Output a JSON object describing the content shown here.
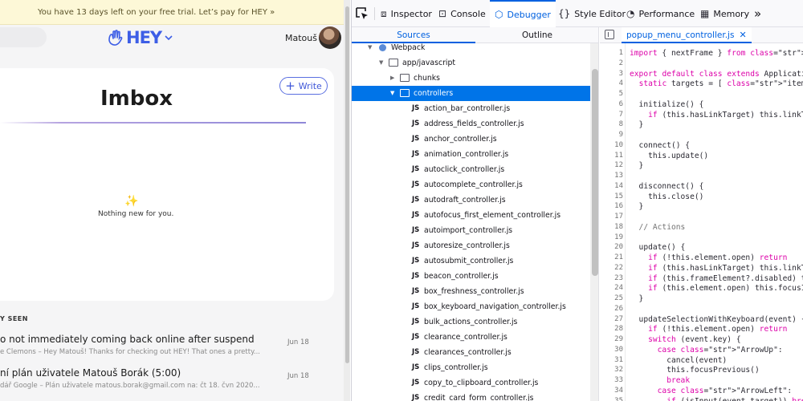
{
  "hey": {
    "trial_banner": "You have 13 days left on your free trial. Let’s pay for HEY »",
    "logo_text": "HEY",
    "user_name": "Matouš",
    "write_label": "Write",
    "imbox_title": "Imbox",
    "empty_message": "Nothing new for you.",
    "seen_heading": "Y SEEN",
    "mails": [
      {
        "subject": "o not immediately coming back online after suspend",
        "preview": "e Clemons – Hey Matouš! Thanks for checking out HEY! That ones a pretty...",
        "date": "Jun 18"
      },
      {
        "subject": "ní plán uživatele Matouš Borák (5:00)",
        "preview": "dář Google – Plán uživatele matous.borak@gmail.com na: čt 18. čvn 2020...",
        "date": "Jun 18"
      }
    ]
  },
  "devtools": {
    "tabs": {
      "inspector": "Inspector",
      "console": "Console",
      "debugger": "Debugger",
      "style_editor": "Style Editor",
      "performance": "Performance",
      "memory": "Memory"
    },
    "sources_tab": "Sources",
    "outline_tab": "Outline",
    "tree": {
      "root": "Webpack",
      "folder_app": "app/javascript",
      "folder_chunks": "chunks",
      "folder_controllers": "controllers",
      "files": [
        "action_bar_controller.js",
        "address_fields_controller.js",
        "anchor_controller.js",
        "animation_controller.js",
        "autoclick_controller.js",
        "autocomplete_controller.js",
        "autodraft_controller.js",
        "autofocus_first_element_controller.js",
        "autoimport_controller.js",
        "autoresize_controller.js",
        "autosubmit_controller.js",
        "beacon_controller.js",
        "box_freshness_controller.js",
        "box_keyboard_navigation_controller.js",
        "bulk_actions_controller.js",
        "clearance_controller.js",
        "clearances_controller.js",
        "clips_controller.js",
        "copy_to_clipboard_controller.js",
        "credit_card_form_controller.js"
      ],
      "js_badge": "JS"
    },
    "editor": {
      "file_tab": "popup_menu_controller.js",
      "lines": [
        {
          "n": "1",
          "code": "import { nextFrame } from \"helpers\""
        },
        {
          "n": "2",
          "code": ""
        },
        {
          "n": "3",
          "code": "export default class extends Application"
        },
        {
          "n": "4",
          "code": "  static targets = [ \"item\", \"link\", \"in"
        },
        {
          "n": "5",
          "code": ""
        },
        {
          "n": "6",
          "code": "  initialize() {"
        },
        {
          "n": "7",
          "code": "    if (this.hasLinkTarget) this.linkTar"
        },
        {
          "n": "8",
          "code": "  }"
        },
        {
          "n": "9",
          "code": ""
        },
        {
          "n": "10",
          "code": "  connect() {"
        },
        {
          "n": "11",
          "code": "    this.update()"
        },
        {
          "n": "12",
          "code": "  }"
        },
        {
          "n": "13",
          "code": ""
        },
        {
          "n": "14",
          "code": "  disconnect() {"
        },
        {
          "n": "15",
          "code": "    this.close()"
        },
        {
          "n": "16",
          "code": "  }"
        },
        {
          "n": "17",
          "code": ""
        },
        {
          "n": "18",
          "code": "  // Actions"
        },
        {
          "n": "19",
          "code": ""
        },
        {
          "n": "20",
          "code": "  update() {"
        },
        {
          "n": "21",
          "code": "    if (!this.element.open) return"
        },
        {
          "n": "22",
          "code": "    if (this.hasLinkTarget) this.linkTar"
        },
        {
          "n": "23",
          "code": "    if (this.frameElement?.disabled) thi"
        },
        {
          "n": "24",
          "code": "    if (this.element.open) this.focusIni"
        },
        {
          "n": "25",
          "code": "  }"
        },
        {
          "n": "26",
          "code": ""
        },
        {
          "n": "27",
          "code": "  updateSelectionWithKeyboard(event) {"
        },
        {
          "n": "28",
          "code": "    if (!this.element.open) return"
        },
        {
          "n": "29",
          "code": "    switch (event.key) {"
        },
        {
          "n": "30",
          "code": "      case \"ArrowUp\":"
        },
        {
          "n": "31",
          "code": "        cancel(event)"
        },
        {
          "n": "32",
          "code": "        this.focusPrevious()"
        },
        {
          "n": "33",
          "code": "        break"
        },
        {
          "n": "34",
          "code": "      case \"ArrowLeft\":"
        },
        {
          "n": "35",
          "code": "        if (isInput(event.target)) break"
        }
      ]
    }
  },
  "colors": {
    "hey_brand": "#3d5ee6",
    "devtools_accent": "#0061e0",
    "selection": "#0074e8",
    "trial_banner_bg": "#fdf8d7"
  }
}
